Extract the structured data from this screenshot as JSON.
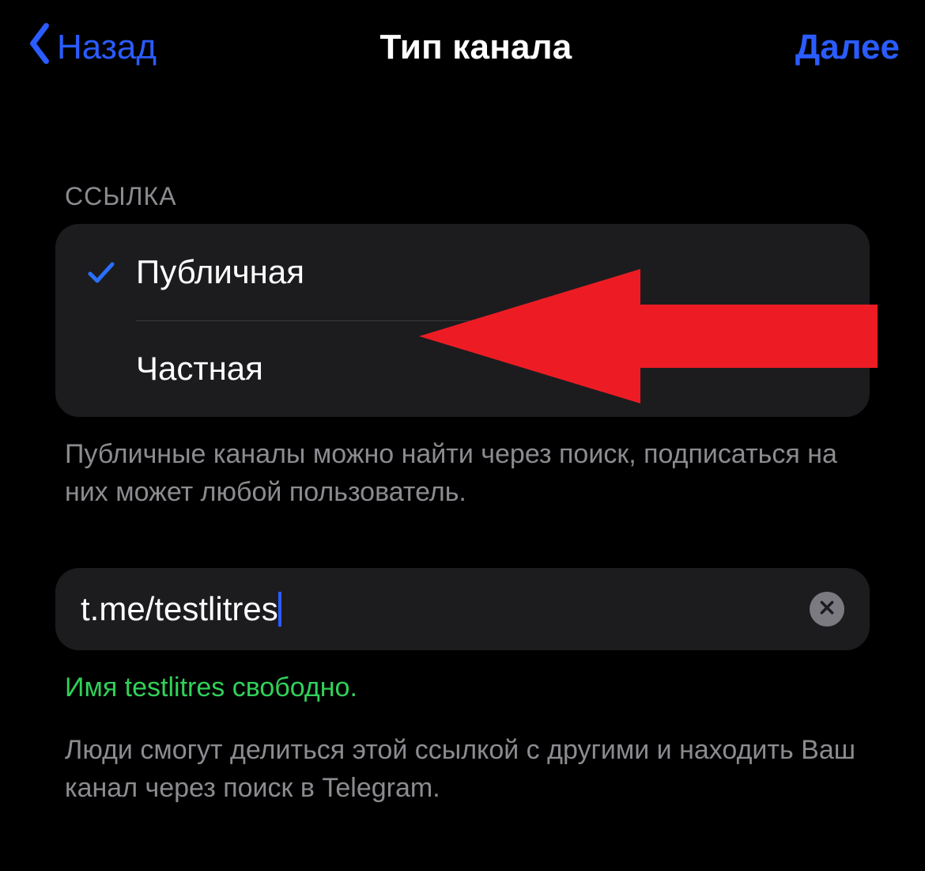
{
  "nav": {
    "back_label": "Назад",
    "title": "Тип канала",
    "next_label": "Далее"
  },
  "link_section": {
    "header": "ССЫЛКА",
    "options": [
      {
        "label": "Публичная",
        "selected": true
      },
      {
        "label": "Частная",
        "selected": false
      }
    ],
    "description": "Публичные каналы можно найти через поиск, подписаться на них может любой пользователь."
  },
  "link_input": {
    "prefix": "t.me/",
    "value": "testlitres",
    "status": "Имя testlitres свободно.",
    "hint": "Люди смогут делиться этой ссылкой с другими и находить Ваш канал через поиск в Telegram."
  },
  "colors": {
    "accent": "#2a5cff",
    "success": "#30d158",
    "card": "#1c1c1e",
    "annotation": "#ed1c24"
  }
}
